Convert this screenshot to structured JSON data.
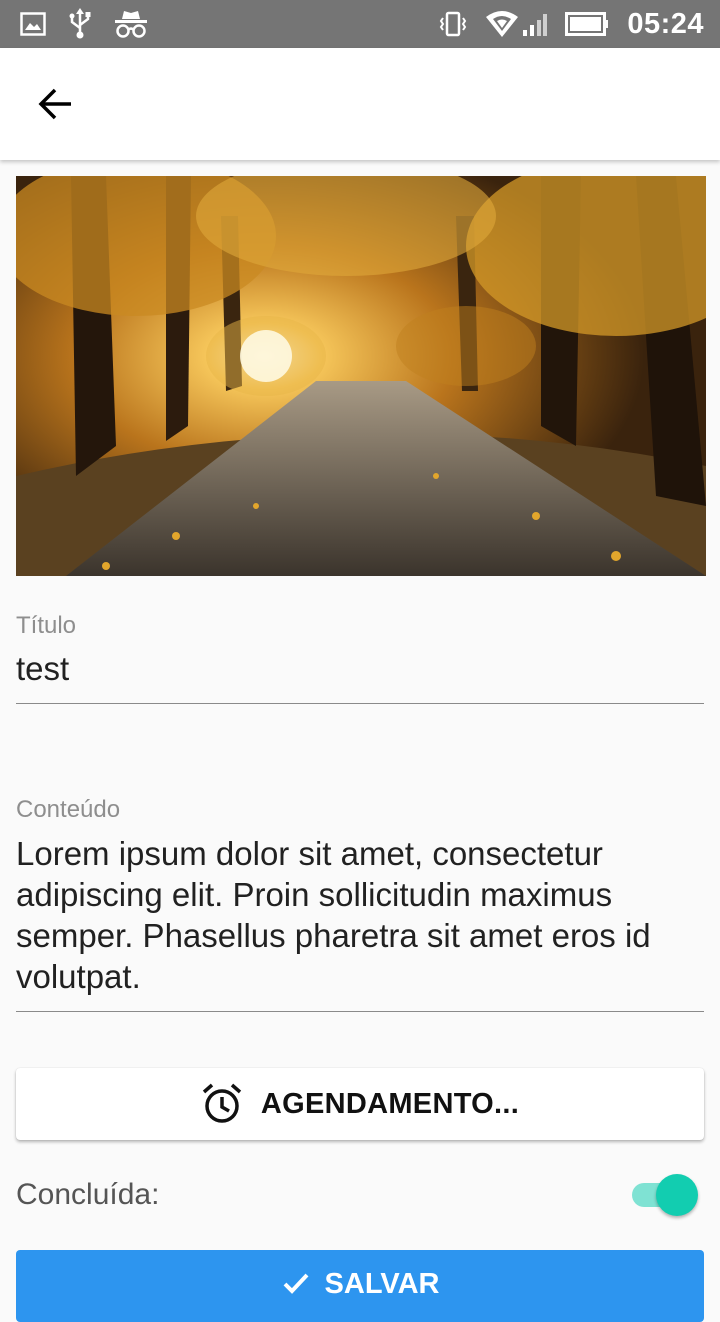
{
  "status_bar": {
    "time": "05:24",
    "left_icons": [
      "image-icon",
      "usb-icon",
      "incognito-icon"
    ],
    "right_icons": [
      "vibrate-icon",
      "wifi-icon",
      "signal-icon",
      "battery-icon"
    ]
  },
  "appbar": {
    "back_icon": "arrow-back-icon"
  },
  "hero": {
    "image": "autumn-road-photo"
  },
  "form": {
    "title_label": "Título",
    "title_value": "test",
    "content_label": "Conteúdo",
    "content_value": "Lorem ipsum dolor sit amet, consectetur adipiscing elit. Proin sollicitudin maximus semper. Phasellus pharetra sit amet eros id volutpat."
  },
  "schedule_button": {
    "label": "AGENDAMENTO...",
    "icon": "alarm-icon"
  },
  "completed": {
    "label": "Concluída:",
    "checked": true
  },
  "save_button": {
    "label": "SALVAR",
    "icon": "check-icon"
  },
  "colors": {
    "status_bar": "#757575",
    "accent": "#12cdb0",
    "accent_track": "#7fe2d3",
    "primary_button": "#2d95ef"
  }
}
